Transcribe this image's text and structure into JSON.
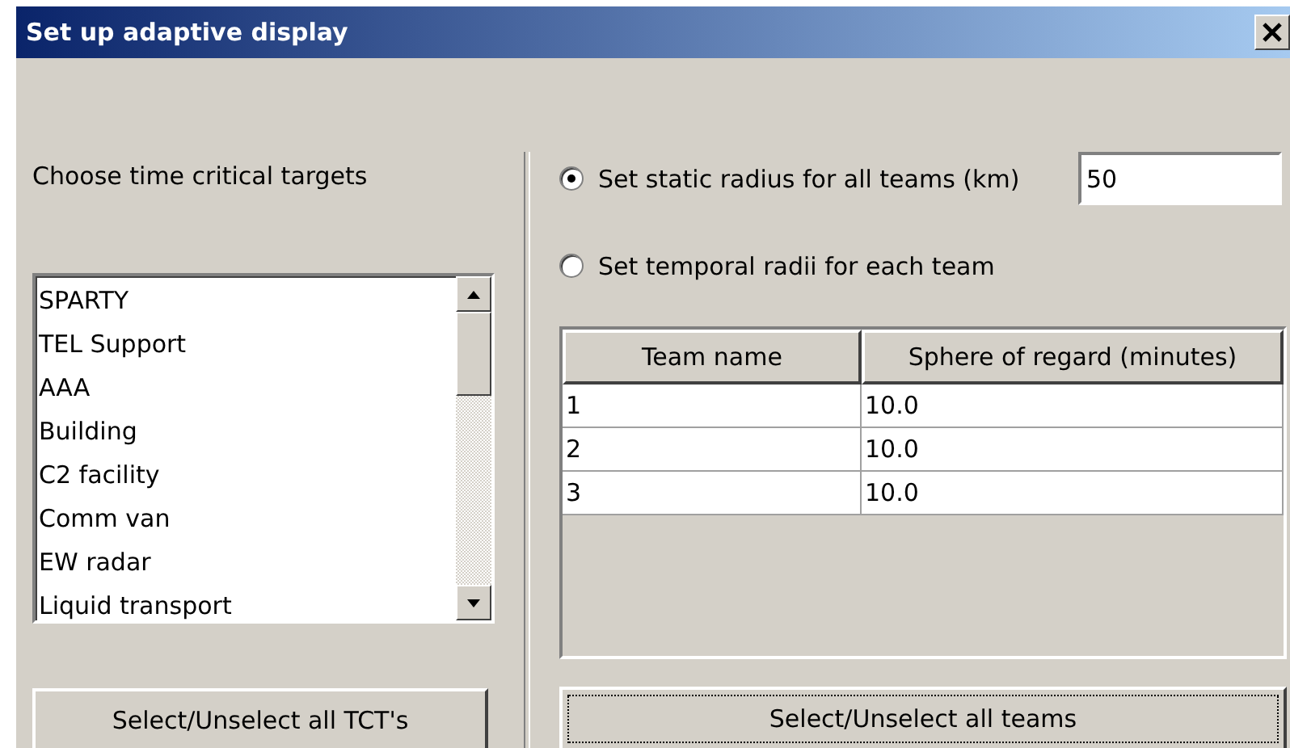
{
  "window": {
    "title": "Set up adaptive display"
  },
  "targets": {
    "label": "Choose time critical targets",
    "items": [
      "SPARTY",
      "TEL Support",
      "AAA",
      "Building",
      "C2 facility",
      "Comm van",
      "EW radar",
      "Liquid transport"
    ],
    "button": "Select/Unselect all TCT's"
  },
  "radius_options": [
    {
      "label": "Set static radius for all teams (km)",
      "selected": true
    },
    {
      "label": "Set temporal radii for each team",
      "selected": false
    }
  ],
  "radius_field": {
    "value": "50"
  },
  "teams_table": {
    "columns": [
      "Team name",
      "Sphere of regard (minutes)"
    ],
    "rows": [
      [
        "1",
        "10.0"
      ],
      [
        "2",
        "10.0"
      ],
      [
        "3",
        "10.0"
      ]
    ]
  },
  "teams_button": {
    "label": "Select/Unselect all teams",
    "focused": true
  }
}
